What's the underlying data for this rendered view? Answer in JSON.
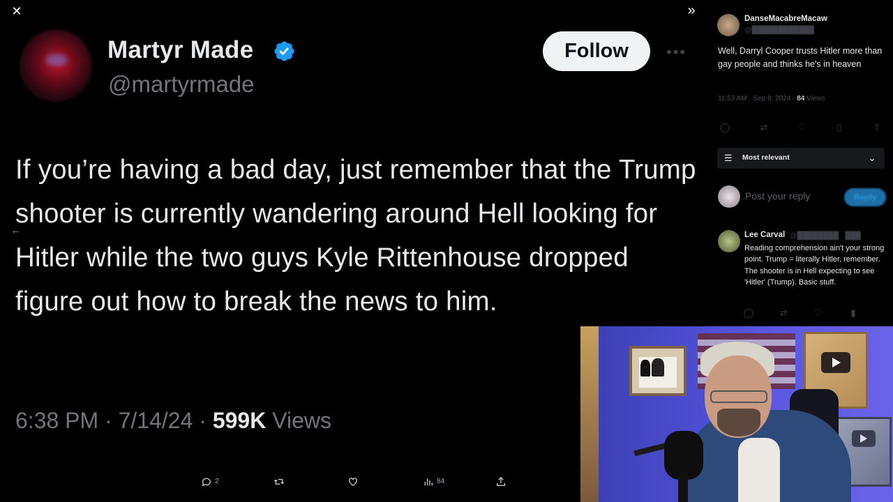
{
  "viewer": {
    "close_icon": "close-icon",
    "collapse_icon": "double-chevron-right-icon",
    "back_icon": "arrow-left-icon"
  },
  "tweet": {
    "author_name": "Martyr Made",
    "author_handle": "@martyrmade",
    "follow_label": "Follow",
    "text": "If you’re having a bad day, just remember that the Trump shooter is currently wandering around Hell looking for Hitler while the two guys Kyle Rittenhouse dropped figure out how to break the news to him.",
    "time": "6:38 PM",
    "date": "7/14/24",
    "views_count": "599K",
    "views_label": "Views",
    "separator": "·",
    "verified_color": "#1d9bf0"
  },
  "action_bar": {
    "reply_count": "2",
    "analytics_count": "84"
  },
  "side": {
    "top_reply": {
      "name": "DanseMacabreMacaw",
      "text": "Well, Darryl Cooper trusts Hitler more than gay people and thinks he's in heaven",
      "time": "11:53 AM",
      "date": "Sep 8, 2024",
      "views_count": "84",
      "views_label": "Views"
    },
    "sort_label": "Most relevant",
    "reply_placeholder": "Post your reply",
    "reply_button": "Reply",
    "second_reply": {
      "name": "Lee Carval",
      "text": "Reading comprehension ain't your strong point. Trump = literally Hitler, remember. The shooter is in Hell expecting to see 'Hitler' (Trump). Basic stuff."
    }
  },
  "webcam": {
    "label": "streamer webcam"
  }
}
